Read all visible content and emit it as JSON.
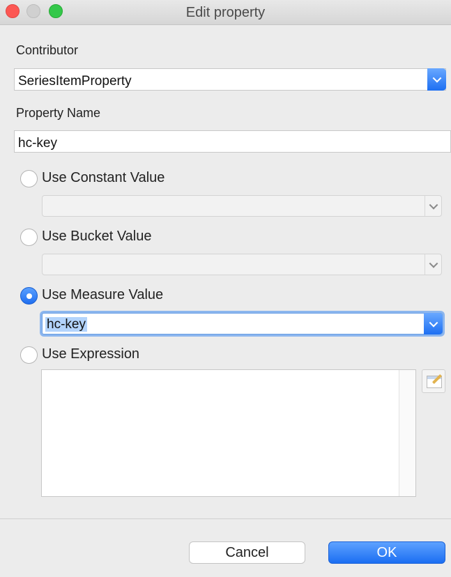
{
  "window": {
    "title": "Edit property"
  },
  "contributor": {
    "label": "Contributor",
    "value": "SeriesItemProperty"
  },
  "property_name": {
    "label": "Property Name",
    "value": "hc-key"
  },
  "options": {
    "constant": {
      "label": "Use Constant Value",
      "checked": false,
      "value": ""
    },
    "bucket": {
      "label": "Use Bucket Value",
      "checked": false,
      "value": ""
    },
    "measure": {
      "label": "Use Measure Value",
      "checked": true,
      "value": "hc-key"
    },
    "expression": {
      "label": "Use Expression",
      "checked": false,
      "value": ""
    }
  },
  "buttons": {
    "cancel": "Cancel",
    "ok": "OK"
  },
  "icons": {
    "combo_arrow": "chevron-down-icon",
    "expression_editor": "edit-expression-icon"
  },
  "colors": {
    "accent": "#1f6ff2",
    "selection": "#b3d4fc"
  }
}
